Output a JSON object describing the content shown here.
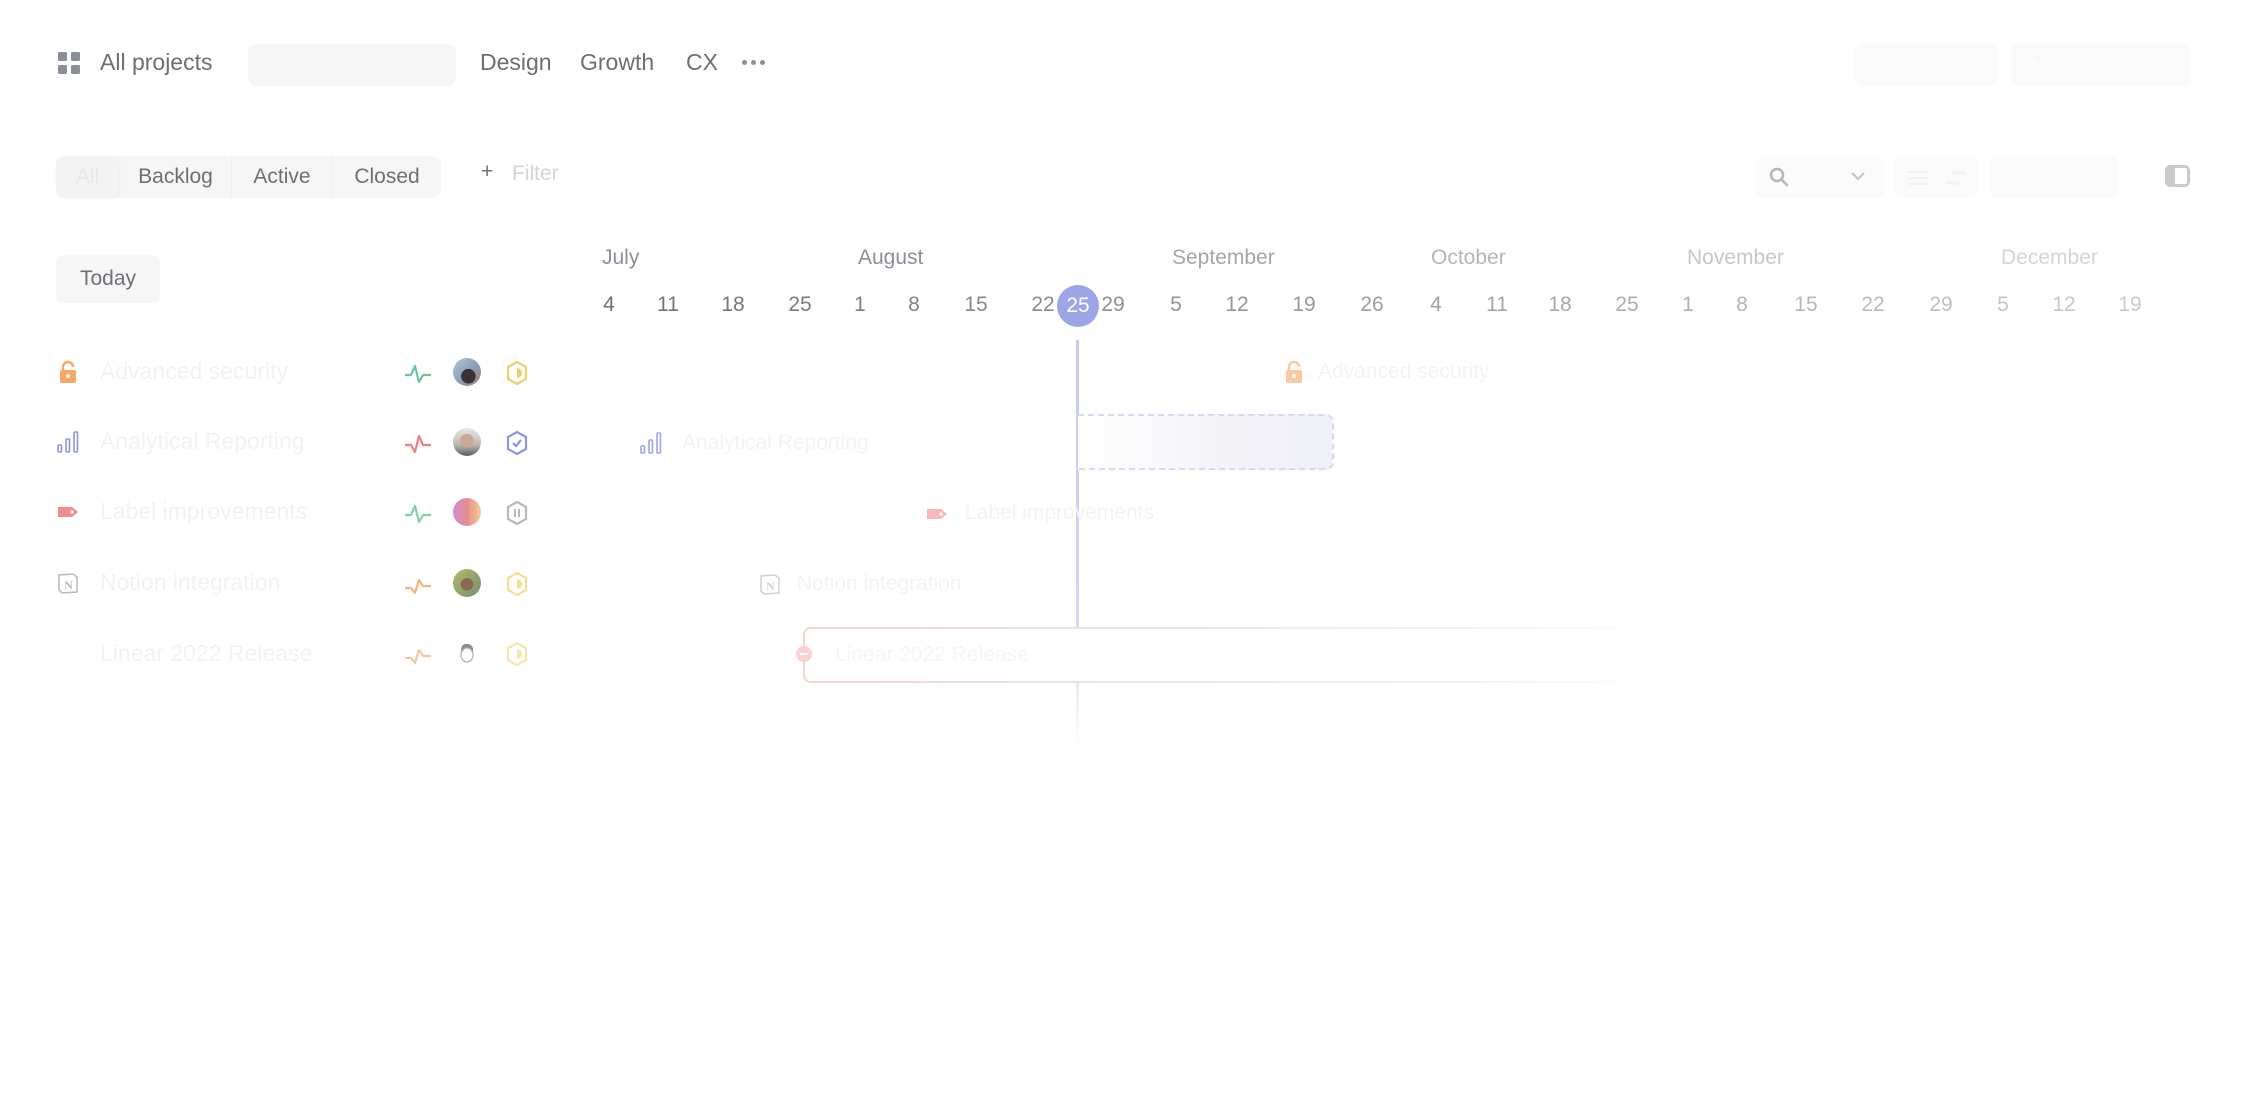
{
  "nav": {
    "grid_icon": "grid-icon",
    "all_projects": "All projects",
    "teams": [
      "Design",
      "Growth",
      "CX"
    ],
    "more_icon": "more-horizontal-icon",
    "right_buttons": [
      {
        "icon": "edit-icon"
      },
      {
        "icon": "plus-icon",
        "glyph": "+"
      }
    ]
  },
  "filters": {
    "tabs": [
      {
        "label": "All",
        "selected": true
      },
      {
        "label": "Backlog",
        "selected": false
      },
      {
        "label": "Active",
        "selected": false
      },
      {
        "label": "Closed",
        "selected": false
      }
    ],
    "add_filter_glyph": "+",
    "add_filter_label": "Filter",
    "search_icon": "search-icon",
    "chevron_icon": "chevron-down-icon",
    "sidebar_toggle_icon": "sidebar-toggle-icon"
  },
  "timeline": {
    "today_button": "Today",
    "months": [
      "July",
      "August",
      "September",
      "October",
      "November",
      "December"
    ],
    "days": [
      "4",
      "11",
      "18",
      "25",
      "1",
      "8",
      "15",
      "22",
      "29",
      "5",
      "12",
      "19",
      "26",
      "4",
      "11",
      "18",
      "25",
      "1",
      "8",
      "15",
      "22",
      "29",
      "5",
      "12",
      "19"
    ],
    "today": "25",
    "accent_color": "#9da5e6"
  },
  "projects": [
    {
      "name": "Advanced security",
      "icon": "lock-icon",
      "icon_color": "#f2994a",
      "health": "on-track",
      "health_color": "#4cb782",
      "avatar": "avatar-woman",
      "status": "started",
      "status_color": "#f2c94c"
    },
    {
      "name": "Analytical Reporting",
      "icon": "bar-chart-icon",
      "icon_color": "#5e6ad2",
      "health": "off-track",
      "health_color": "#eb5757",
      "avatar": "avatar-man-glasses",
      "status": "completed",
      "status_color": "#5e6ad2"
    },
    {
      "name": "Label improvements",
      "icon": "tag-icon",
      "icon_color": "#eb5757",
      "health": "on-track",
      "health_color": "#4cb782",
      "avatar": "avatar-colorful",
      "status": "paused",
      "status_color": "#95a2b3"
    },
    {
      "name": "Notion integration",
      "icon": "notion-icon",
      "icon_color": "#9b9ba0",
      "health": "at-risk",
      "health_color": "#f2994a",
      "avatar": "avatar-man-flowers",
      "status": "started",
      "status_color": "#f2c94c"
    },
    {
      "name": "Linear 2022 Release",
      "icon": "none",
      "icon_color": "",
      "health": "at-risk",
      "health_color": "#f2994a",
      "avatar": "avatar-illustration",
      "status": "started",
      "status_color": "#f2c94c"
    }
  ]
}
